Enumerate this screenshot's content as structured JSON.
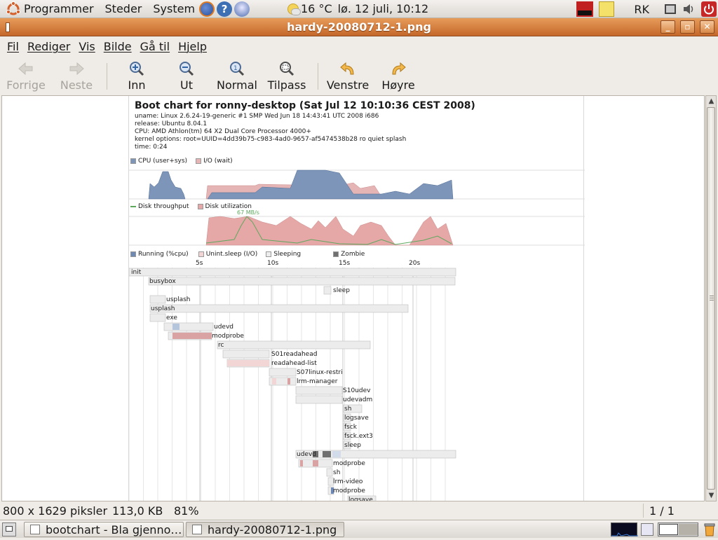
{
  "top_panel": {
    "menus": [
      "Programmer",
      "Steder",
      "System"
    ],
    "weather": "16 °C",
    "clock": "lø. 12 juli, 10:12",
    "user": "RK"
  },
  "window": {
    "title": "hardy-20080712-1.png"
  },
  "menubar": [
    "Fil",
    "Rediger",
    "Vis",
    "Bilde",
    "Gå til",
    "Hjelp"
  ],
  "toolbar": {
    "previous": "Forrige",
    "next": "Neste",
    "zoom_in": "Inn",
    "zoom_out": "Ut",
    "normal": "Normal",
    "fit": "Tilpass",
    "rotate_left": "Venstre",
    "rotate_right": "Høyre"
  },
  "bootchart": {
    "title": "Boot chart for ronny-desktop (Sat Jul 12 10:10:36 CEST 2008)",
    "meta": [
      "uname: Linux 2.6.24-19-generic #1 SMP Wed Jun 18 14:43:41 UTC 2008 i686",
      "release: Ubuntu 8.04.1",
      "CPU: AMD Athlon(tm) 64 X2 Dual Core Processor 4000+",
      "kernel options: root=UUID=4dd39b75-c983-4ad0-9657-af5474538b28 ro quiet splash",
      "time: 0:24"
    ],
    "legend_cpu": [
      "CPU (user+sys)",
      "I/O (wait)"
    ],
    "legend_disk": [
      "Disk throughput",
      "Disk utilization"
    ],
    "disk_peak": "67 MB/s",
    "legend_proc": [
      "Running (%cpu)",
      "Unint.sleep (I/O)",
      "Sleeping",
      "Zombie"
    ],
    "time_ticks": [
      "5s",
      "10s",
      "15s",
      "20s"
    ],
    "processes": [
      "init",
      "busybox",
      "sleep",
      "usplash",
      "usplash",
      "exe",
      "udevd",
      "modprobe",
      "rc",
      "S01readahead",
      "readahead-list",
      "S07linux-restri",
      "lrm-manager",
      "S10udev",
      "udevadm",
      "sh",
      "logsave",
      "fsck",
      "fsck.ext3",
      "sleep",
      "udevd",
      "modprobe",
      "sh",
      "lrm-video",
      "modprobe",
      "logsave"
    ],
    "colors": {
      "cpu": "#7d95b8",
      "io": "#e5b4b4",
      "disk_util": "#e6a7a7",
      "disk_line": "#5ea85e",
      "running": "#6d89b4",
      "sleeping": "#ececec",
      "zombie": "#707070"
    }
  },
  "statusbar": {
    "dimensions": "800 x 1629 piksler",
    "filesize": "113,0 KB",
    "zoom": "81%",
    "page": "1 / 1"
  },
  "taskbar": [
    {
      "label": "bootchart - Bla gjenno…"
    },
    {
      "label": "hardy-20080712-1.png"
    }
  ]
}
